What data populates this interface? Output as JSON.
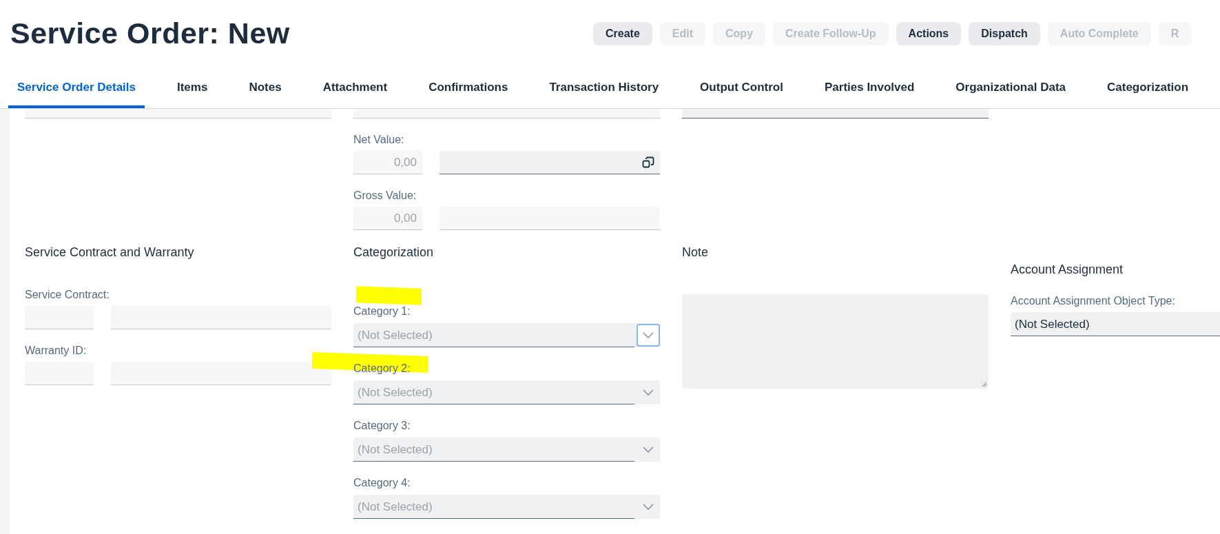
{
  "header": {
    "title": "Service Order: New",
    "buttons": [
      {
        "label": "Create",
        "disabled": false
      },
      {
        "label": "Edit",
        "disabled": true
      },
      {
        "label": "Copy",
        "disabled": true
      },
      {
        "label": "Create Follow-Up",
        "disabled": true
      },
      {
        "label": "Actions",
        "disabled": false
      },
      {
        "label": "Dispatch",
        "disabled": false
      },
      {
        "label": "Auto Complete",
        "disabled": true
      },
      {
        "label": "R",
        "disabled": true
      }
    ]
  },
  "tabs": [
    {
      "label": "Service Order Details",
      "selected": true
    },
    {
      "label": "Items",
      "selected": false
    },
    {
      "label": "Notes",
      "selected": false
    },
    {
      "label": "Attachment",
      "selected": false
    },
    {
      "label": "Confirmations",
      "selected": false
    },
    {
      "label": "Transaction History",
      "selected": false
    },
    {
      "label": "Output Control",
      "selected": false
    },
    {
      "label": "Parties Involved",
      "selected": false
    },
    {
      "label": "Organizational Data",
      "selected": false
    },
    {
      "label": "Categorization",
      "selected": false
    }
  ],
  "values": [
    {
      "label": "Net Value:",
      "fields": [
        {
          "value": "0,00",
          "readonly": true
        },
        {
          "readonly": false,
          "kind": "value-help"
        }
      ]
    },
    {
      "label": "Gross Value:",
      "fields": [
        {
          "value": "0,00",
          "readonly": true
        },
        {
          "readonly": true
        }
      ]
    }
  ],
  "service_contract": {
    "title": "Service Contract and Warranty",
    "rows": [
      {
        "label": "Service Contract:",
        "fields": [
          {
            "readonly": true
          },
          {
            "readonly": true
          }
        ]
      },
      {
        "label": "Warranty ID:",
        "fields": [
          {
            "readonly": true
          },
          {
            "readonly": true
          }
        ]
      }
    ]
  },
  "categorization": {
    "title": "Categorization",
    "categories": [
      {
        "label": "Category 1:",
        "placeholder": "(Not Selected)",
        "focused": true,
        "highlighted": true
      },
      {
        "label": "Category 2:",
        "placeholder": "(Not Selected)",
        "focused": false,
        "highlighted": true
      },
      {
        "label": "Category 3:",
        "placeholder": "(Not Selected)",
        "focused": false,
        "highlighted": false
      },
      {
        "label": "Category 4:",
        "placeholder": "(Not Selected)",
        "focused": false,
        "highlighted": false
      }
    ]
  },
  "note": {
    "title": "Note"
  },
  "account_assignment": {
    "title": "Account Assignment",
    "label": "Account Assignment Object Type:",
    "value": "(Not Selected)"
  }
}
